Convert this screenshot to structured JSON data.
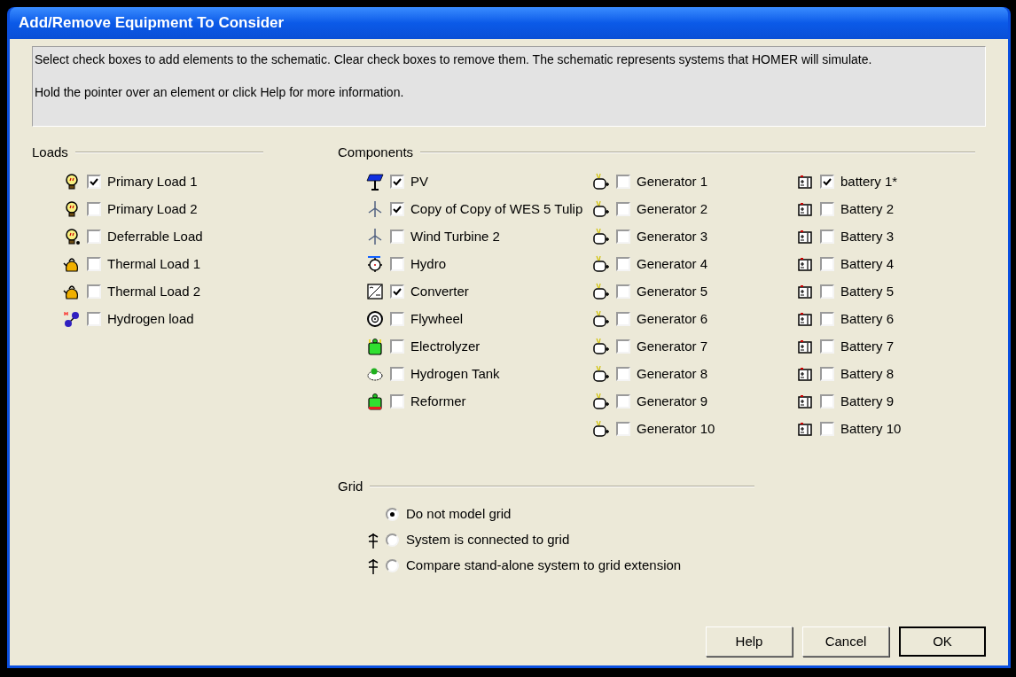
{
  "window": {
    "title": "Add/Remove Equipment To Consider"
  },
  "instructions": [
    "Select check boxes to add elements to the schematic. Clear check boxes to remove them. The schematic represents systems that HOMER will simulate.",
    "Hold the pointer over an element or click Help for more information."
  ],
  "loads": {
    "heading": "Loads",
    "items": [
      {
        "kind": "bulb",
        "label": "Primary Load 1",
        "checked": true
      },
      {
        "kind": "bulb",
        "label": "Primary Load 2",
        "checked": false
      },
      {
        "kind": "deferrable",
        "label": "Deferrable Load",
        "checked": false
      },
      {
        "kind": "kettle",
        "label": "Thermal Load 1",
        "checked": false
      },
      {
        "kind": "kettle",
        "label": "Thermal Load 2",
        "checked": false
      },
      {
        "kind": "hydrogen",
        "label": "Hydrogen load",
        "checked": false
      }
    ]
  },
  "components": {
    "heading": "Components",
    "columns": [
      [
        {
          "kind": "pv",
          "label": "PV",
          "checked": true
        },
        {
          "kind": "turbine",
          "label": "Copy of Copy of WES 5 Tulip",
          "checked": true
        },
        {
          "kind": "turbine",
          "label": "Wind Turbine 2",
          "checked": false
        },
        {
          "kind": "hydro",
          "label": "Hydro",
          "checked": false
        },
        {
          "kind": "converter",
          "label": "Converter",
          "checked": true
        },
        {
          "kind": "flywheel",
          "label": "Flywheel",
          "checked": false
        },
        {
          "kind": "electrolyzer",
          "label": "Electrolyzer",
          "checked": false
        },
        {
          "kind": "tank",
          "label": "Hydrogen Tank",
          "checked": false
        },
        {
          "kind": "reformer",
          "label": "Reformer",
          "checked": false
        }
      ],
      [
        {
          "kind": "generator",
          "label": "Generator 1",
          "checked": false
        },
        {
          "kind": "generator",
          "label": "Generator 2",
          "checked": false
        },
        {
          "kind": "generator",
          "label": "Generator 3",
          "checked": false
        },
        {
          "kind": "generator",
          "label": "Generator 4",
          "checked": false
        },
        {
          "kind": "generator",
          "label": "Generator 5",
          "checked": false
        },
        {
          "kind": "generator",
          "label": "Generator 6",
          "checked": false
        },
        {
          "kind": "generator",
          "label": "Generator 7",
          "checked": false
        },
        {
          "kind": "generator",
          "label": "Generator 8",
          "checked": false
        },
        {
          "kind": "generator",
          "label": "Generator 9",
          "checked": false
        },
        {
          "kind": "generator",
          "label": "Generator 10",
          "checked": false
        }
      ],
      [
        {
          "kind": "battery",
          "label": "battery 1*",
          "checked": true
        },
        {
          "kind": "battery",
          "label": "Battery 2",
          "checked": false
        },
        {
          "kind": "battery",
          "label": "Battery 3",
          "checked": false
        },
        {
          "kind": "battery",
          "label": "Battery 4",
          "checked": false
        },
        {
          "kind": "battery",
          "label": "Battery 5",
          "checked": false
        },
        {
          "kind": "battery",
          "label": "Battery 6",
          "checked": false
        },
        {
          "kind": "battery",
          "label": "Battery 7",
          "checked": false
        },
        {
          "kind": "battery",
          "label": "Battery 8",
          "checked": false
        },
        {
          "kind": "battery",
          "label": "Battery 9",
          "checked": false
        },
        {
          "kind": "battery",
          "label": "Battery 10",
          "checked": false
        }
      ]
    ]
  },
  "grid": {
    "heading": "Grid",
    "options": [
      {
        "kind": "none",
        "label": "Do not model grid",
        "selected": true
      },
      {
        "kind": "tower",
        "label": "System is connected to grid",
        "selected": false
      },
      {
        "kind": "tower",
        "label": "Compare stand-alone system to grid extension",
        "selected": false
      }
    ]
  },
  "buttons": [
    {
      "label": "Help",
      "default": false
    },
    {
      "label": "Cancel",
      "default": false
    },
    {
      "label": "OK",
      "default": true
    }
  ]
}
